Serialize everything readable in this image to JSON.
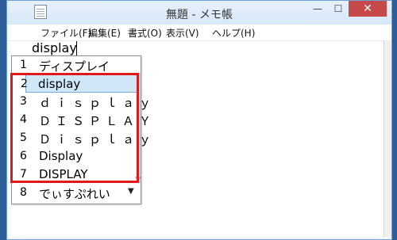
{
  "window": {
    "title": "無題 - メモ帳",
    "buttons": {
      "minimize": "—",
      "maximize": "☐",
      "close": "✕"
    }
  },
  "menu": {
    "items": [
      "ファイル(F)",
      "編集(E)",
      "書式(O)",
      "表示(V)",
      "ヘルプ(H)"
    ]
  },
  "editor": {
    "typed_text": "display"
  },
  "ime_candidates": {
    "selected_index": 2,
    "items": [
      {
        "num": "1",
        "text": "ディスプレイ"
      },
      {
        "num": "2",
        "text": "display"
      },
      {
        "num": "3",
        "text": "ｄｉｓｐｌａｙ"
      },
      {
        "num": "4",
        "text": "ＤＩＳＰＬＡＹ"
      },
      {
        "num": "5",
        "text": "Ｄｉｓｐｌａｙ"
      },
      {
        "num": "6",
        "text": "Display"
      },
      {
        "num": "7",
        "text": "DISPLAY"
      },
      {
        "num": "8",
        "text": "でぃすぷれい"
      }
    ],
    "scroll_down_glyph": "▼"
  }
}
